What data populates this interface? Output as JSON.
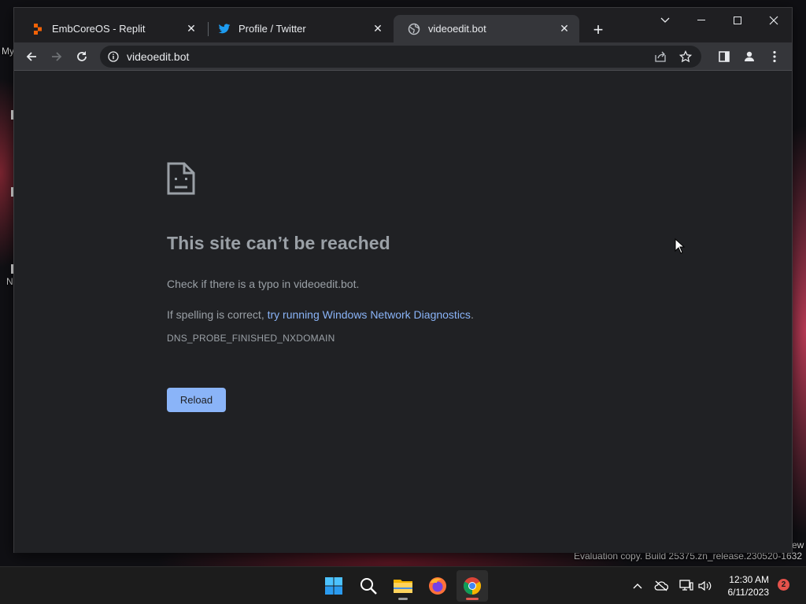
{
  "desktop": {
    "left_text_1": "My",
    "left_text_2": "N",
    "watermark": "Evaluation copy. Build 25375.zn_release.230520-1632",
    "watermark_partial": "ew"
  },
  "browser": {
    "tabs": [
      {
        "title": "EmbCoreOS - Replit",
        "icon": "replit-icon",
        "active": false
      },
      {
        "title": "Profile / Twitter",
        "icon": "twitter-icon",
        "active": false
      },
      {
        "title": "videoedit.bot",
        "icon": "globe-icon",
        "active": true
      }
    ],
    "address": "videoedit.bot"
  },
  "error_page": {
    "title": "This site can’t be reached",
    "line1": "Check if there is a typo in videoedit.bot.",
    "line2_prefix": "If spelling is correct, ",
    "line2_link": "try running Windows Network Diagnostics",
    "line2_suffix": ".",
    "error_code": "DNS_PROBE_FINISHED_NXDOMAIN",
    "reload_label": "Reload"
  },
  "taskbar": {
    "apps": [
      "start-icon",
      "search-icon",
      "file-explorer-icon",
      "firefox-icon",
      "chrome-icon"
    ],
    "time": "12:30 AM",
    "date": "6/11/2023",
    "notifications": "2"
  },
  "colors": {
    "page_bg": "#202124",
    "link": "#8ab4f8",
    "button": "#8ab4f8",
    "text_muted": "#9aa0a6"
  }
}
